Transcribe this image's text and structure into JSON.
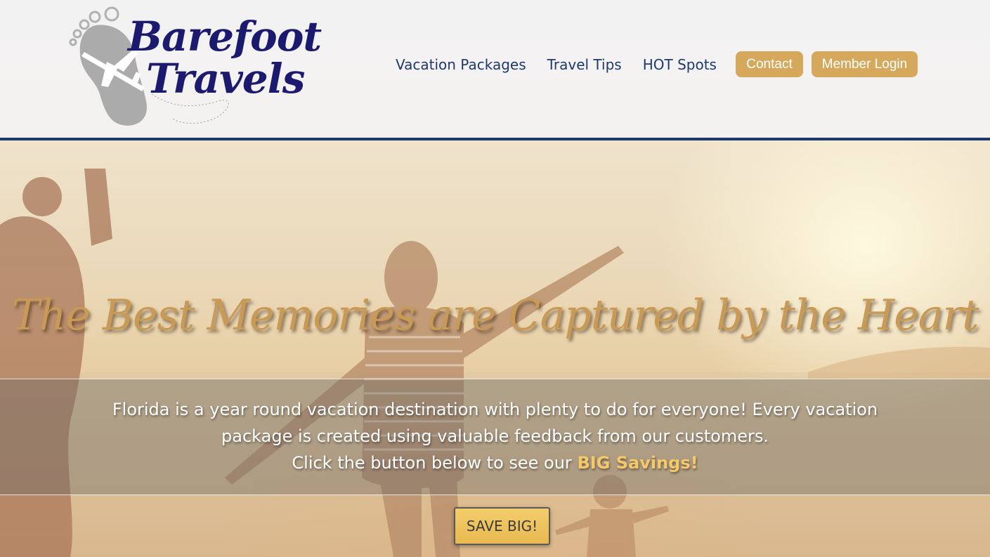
{
  "brand": {
    "line1": "Barefoot",
    "line2": "Travels"
  },
  "nav": {
    "links": [
      "Vacation Packages",
      "Travel Tips",
      "HOT Spots"
    ],
    "contact_label": "Contact",
    "login_label": "Member Login"
  },
  "hero": {
    "headline": "The Best Memories are Captured by the Heart",
    "body_line1": "Florida is a year round vacation destination with plenty to do for everyone! Every vacation",
    "body_line2": "package is created using valuable feedback from our customers.",
    "body_line3_prefix": "Click the button below to see our ",
    "body_line3_highlight": "BIG Savings!",
    "cta_label": "SAVE BIG!"
  },
  "colors": {
    "navy": "#1d3a6b",
    "gold": "#d6a85c",
    "headline_gold": "#c89a55",
    "highlight": "#f5c86a"
  },
  "icons": {
    "logo_graphic": "footprint-airplane-icon"
  }
}
